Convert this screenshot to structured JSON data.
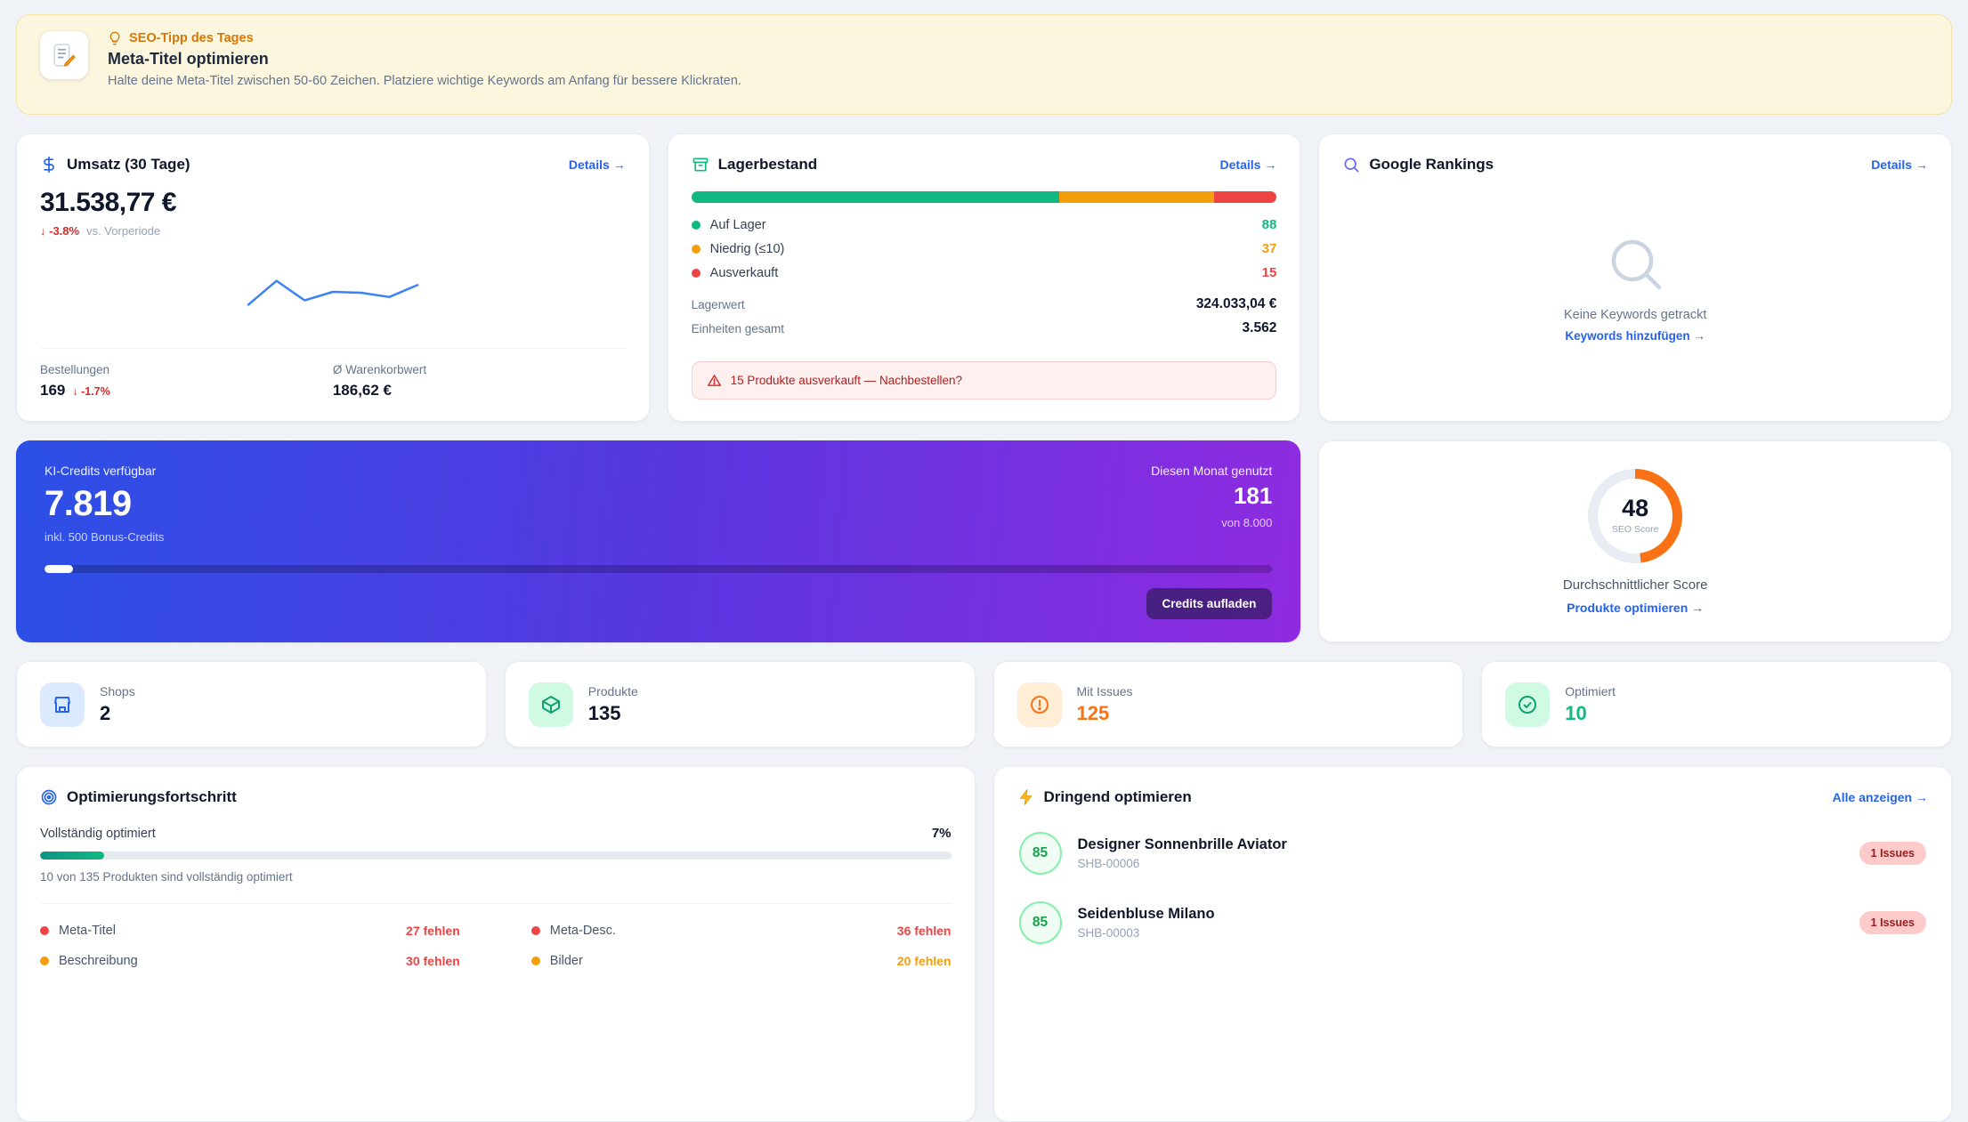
{
  "colors": {
    "accent_blue": "#2563eb",
    "green": "#10b981",
    "amber": "#f59e0b",
    "orange": "#f97316",
    "red": "#ef4444",
    "purple": "#9333ea"
  },
  "banner": {
    "tip_label": "SEO-Tipp des Tages",
    "title": "Meta-Titel optimieren",
    "description": "Halte deine Meta-Titel zwischen 50-60 Zeichen. Platziere wichtige Keywords am Anfang für bessere Klickraten."
  },
  "revenue": {
    "title": "Umsatz (30 Tage)",
    "details_link": "Details →",
    "value": "31.538,77 €",
    "change": "↓ -3.8%",
    "change_context": "vs. Vorperiode",
    "orders_label": "Bestellungen",
    "orders_value": "169",
    "orders_change": "↓ -1.7%",
    "basket_label": "Ø Warenkorbwert",
    "basket_value": "186,62 €",
    "sparkline": [
      22,
      78,
      32,
      52,
      50,
      40,
      68
    ]
  },
  "inventory": {
    "title": "Lagerbestand",
    "details_link": "Details →",
    "segments": [
      {
        "label": "Auf Lager",
        "value": "88",
        "color": "#10b981",
        "pct": 62.9
      },
      {
        "label": "Niedrig (≤10)",
        "value": "37",
        "color": "#f59e0b",
        "pct": 26.4
      },
      {
        "label": "Ausverkauft",
        "value": "15",
        "color": "#ef4444",
        "pct": 10.7
      }
    ],
    "stock_value_label": "Lagerwert",
    "stock_value": "324.033,04 €",
    "units_label": "Einheiten gesamt",
    "units_value": "3.562",
    "alert_text": "15 Produkte ausverkauft — Nachbestellen?"
  },
  "rankings": {
    "title": "Google Rankings",
    "details_link": "Details →",
    "empty_text": "Keine Keywords getrackt",
    "add_link": "Keywords hinzufügen →"
  },
  "credits": {
    "available_label": "KI-Credits verfügbar",
    "available_value": "7.819",
    "bonus_note": "inkl. 500 Bonus-Credits",
    "used_label": "Diesen Monat genutzt",
    "used_value": "181",
    "used_total": "von 8.000",
    "button_label": "Credits aufladen",
    "used_pct": 2.3
  },
  "seo_score": {
    "value": "48",
    "gauge_label": "SEO Score",
    "caption": "Durchschnittlicher Score",
    "link": "Produkte optimieren →",
    "pct": 48
  },
  "stats": [
    {
      "label": "Shops",
      "value": "2"
    },
    {
      "label": "Produkte",
      "value": "135"
    },
    {
      "label": "Mit Issues",
      "value": "125"
    },
    {
      "label": "Optimiert",
      "value": "10"
    }
  ],
  "optimization": {
    "title": "Optimierungsfortschritt",
    "row_label": "Vollständig optimiert",
    "row_value": "7%",
    "pct": 7,
    "caption": "10 von 135 Produkten sind vollständig optimiert",
    "fields": [
      {
        "label": "Meta-Titel",
        "count": "27 fehlen",
        "dot_color": "#ef4444",
        "count_color": "#ef4444"
      },
      {
        "label": "Meta-Desc.",
        "count": "36 fehlen",
        "dot_color": "#ef4444",
        "count_color": "#ef4444"
      },
      {
        "label": "Beschreibung",
        "count": "30 fehlen",
        "dot_color": "#f59e0b",
        "count_color": "#ef4444"
      },
      {
        "label": "Bilder",
        "count": "20 fehlen",
        "dot_color": "#f59e0b",
        "count_color": "#f59e0b"
      }
    ]
  },
  "urgent": {
    "title": "Dringend optimieren",
    "view_all_link": "Alle anzeigen →",
    "items": [
      {
        "score": "85",
        "name": "Designer Sonnenbrille Aviator",
        "sku": "SHB-00006",
        "issues": "1 Issues"
      },
      {
        "score": "85",
        "name": "Seidenbluse Milano",
        "sku": "SHB-00003",
        "issues": "1 Issues"
      }
    ]
  }
}
